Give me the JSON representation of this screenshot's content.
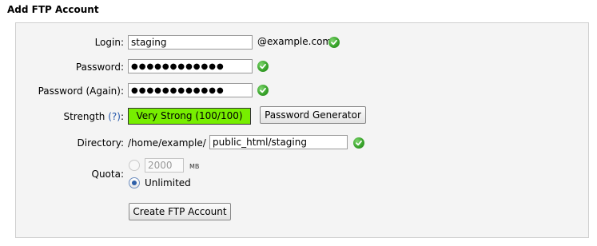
{
  "heading": "Add FTP Account",
  "form": {
    "login": {
      "label": "Login:",
      "value": "staging",
      "suffix": "@example.com"
    },
    "password": {
      "label": "Password:",
      "value": "●●●●●●●●●●●●"
    },
    "password_again": {
      "label": "Password (Again):",
      "value": "●●●●●●●●●●●●"
    },
    "strength": {
      "label": "Strength",
      "help_link": "(?)",
      "colon": ":",
      "value": "Very Strong (100/100)",
      "color": "#77ee00"
    },
    "generator_button": "Password Generator",
    "directory": {
      "label": "Directory:",
      "prefix": "/home/example/",
      "value": "public_html/staging"
    },
    "quota": {
      "label": "Quota:",
      "limited_value": "2000",
      "unit": "MB",
      "unlimited_label": "Unlimited",
      "selected": "unlimited"
    },
    "submit_button": "Create FTP Account"
  },
  "icons": {
    "valid": "check-circle-icon",
    "valid_color": "#3aa52c"
  }
}
